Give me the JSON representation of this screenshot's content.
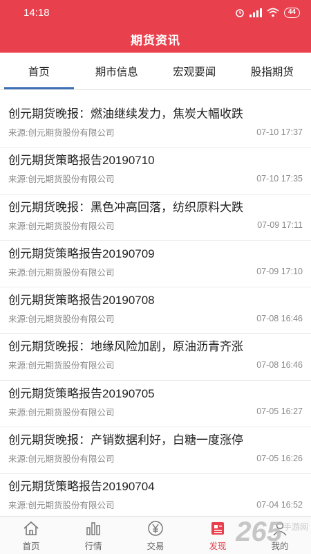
{
  "status_bar": {
    "time": "14:18",
    "battery": "44"
  },
  "header": {
    "title": "期货资讯"
  },
  "tabs": [
    {
      "label": "首页",
      "active": true
    },
    {
      "label": "期市信息",
      "active": false
    },
    {
      "label": "宏观要闻",
      "active": false
    },
    {
      "label": "股指期货",
      "active": false
    }
  ],
  "news": [
    {
      "title": "创元期货晚报：燃油继续发力，焦炭大幅收跌",
      "source": "来源:创元期货股份有限公司",
      "time": "07-10 17:37"
    },
    {
      "title": "创元期货策略报告20190710",
      "source": "来源:创元期货股份有限公司",
      "time": "07-10 17:35"
    },
    {
      "title": "创元期货晚报：黑色冲高回落，纺织原料大跌",
      "source": "来源:创元期货股份有限公司",
      "time": "07-09 17:11"
    },
    {
      "title": "创元期货策略报告20190709",
      "source": "来源:创元期货股份有限公司",
      "time": "07-09 17:10"
    },
    {
      "title": "创元期货策略报告20190708",
      "source": "来源:创元期货股份有限公司",
      "time": "07-08 16:46"
    },
    {
      "title": "创元期货晚报：地缘风险加剧，原油沥青齐涨",
      "source": "来源:创元期货股份有限公司",
      "time": "07-08 16:46"
    },
    {
      "title": "创元期货策略报告20190705",
      "source": "来源:创元期货股份有限公司",
      "time": "07-05 16:27"
    },
    {
      "title": "创元期货晚报：产销数据利好，白糖一度涨停",
      "source": "来源:创元期货股份有限公司",
      "time": "07-05 16:26"
    },
    {
      "title": "创元期货策略报告20190704",
      "source": "来源:创元期货股份有限公司",
      "time": "07-04 16:52"
    }
  ],
  "bottom_nav": [
    {
      "label": "首页",
      "icon": "home-icon",
      "active": false
    },
    {
      "label": "行情",
      "icon": "bar-chart-icon",
      "active": false
    },
    {
      "label": "交易",
      "icon": "yen-coin-icon",
      "active": false
    },
    {
      "label": "发现",
      "icon": "discover-icon",
      "active": true
    },
    {
      "label": "我的",
      "icon": "profile-icon",
      "active": false
    }
  ],
  "watermark": {
    "logo": "265",
    "text": "手游网"
  },
  "colors": {
    "brand_red": "#e8414d",
    "tab_indicator": "#3d6fb6"
  }
}
